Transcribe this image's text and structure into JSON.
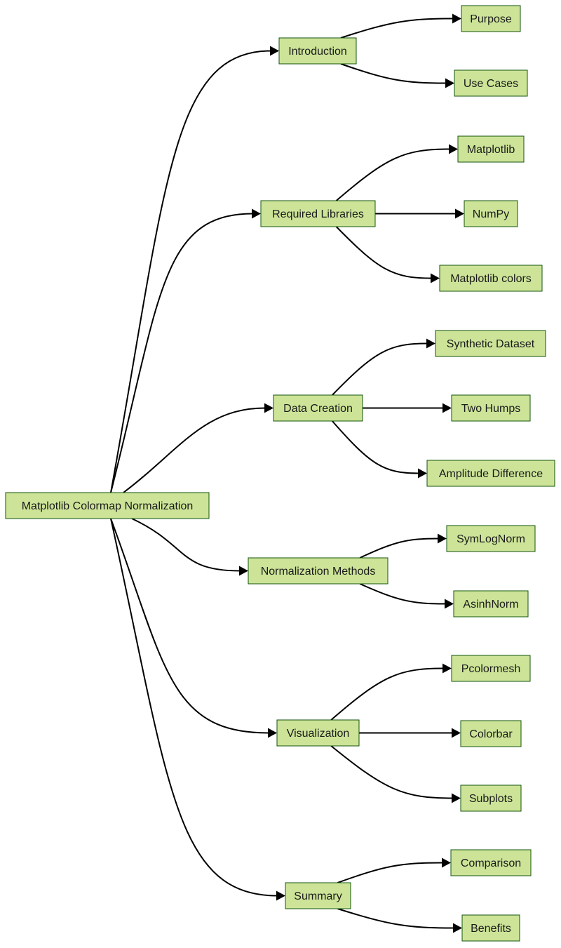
{
  "diagram": {
    "type": "flowchart-left-to-right",
    "colors": {
      "node_fill": "#cde498",
      "node_border": "#13540c",
      "edge": "#000000",
      "text": "#1a1a1a"
    },
    "root": {
      "id": "root",
      "label": "Matplotlib Colormap Normalization"
    },
    "branches": [
      {
        "id": "intro",
        "label": "Introduction",
        "children": [
          {
            "id": "purpose",
            "label": "Purpose"
          },
          {
            "id": "usecases",
            "label": "Use Cases"
          }
        ]
      },
      {
        "id": "libs",
        "label": "Required Libraries",
        "children": [
          {
            "id": "mpl",
            "label": "Matplotlib"
          },
          {
            "id": "numpy",
            "label": "NumPy"
          },
          {
            "id": "mplcolors",
            "label": "Matplotlib colors"
          }
        ]
      },
      {
        "id": "data",
        "label": "Data Creation",
        "children": [
          {
            "id": "synth",
            "label": "Synthetic Dataset"
          },
          {
            "id": "humps",
            "label": "Two Humps"
          },
          {
            "id": "amp",
            "label": "Amplitude Difference"
          }
        ]
      },
      {
        "id": "norm",
        "label": "Normalization Methods",
        "children": [
          {
            "id": "symlog",
            "label": "SymLogNorm"
          },
          {
            "id": "asinh",
            "label": "AsinhNorm"
          }
        ]
      },
      {
        "id": "vis",
        "label": "Visualization",
        "children": [
          {
            "id": "pcm",
            "label": "Pcolormesh"
          },
          {
            "id": "cbar",
            "label": "Colorbar"
          },
          {
            "id": "subplots",
            "label": "Subplots"
          }
        ]
      },
      {
        "id": "summary",
        "label": "Summary",
        "children": [
          {
            "id": "comparison",
            "label": "Comparison"
          },
          {
            "id": "benefits",
            "label": "Benefits"
          }
        ]
      }
    ]
  }
}
